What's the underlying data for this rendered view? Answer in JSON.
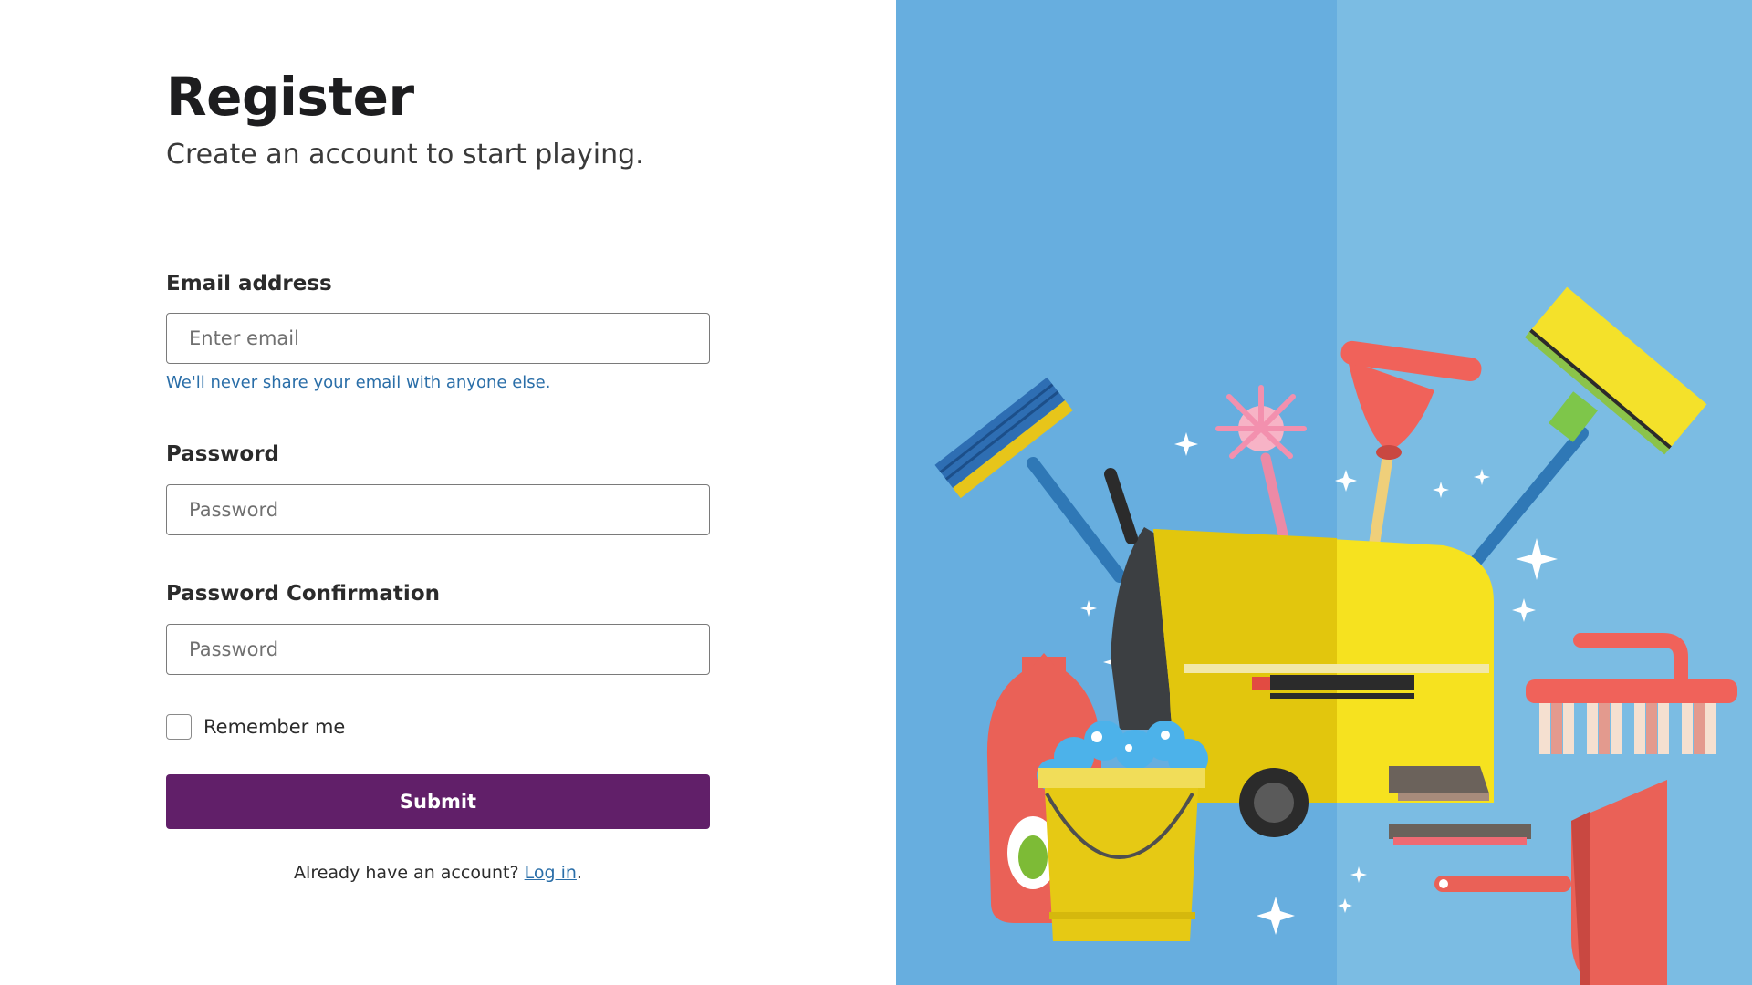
{
  "register": {
    "title": "Register",
    "subtitle": "Create an account to start playing.",
    "email": {
      "label": "Email address",
      "placeholder": "Enter email",
      "help": "We'll never share your email with anyone else."
    },
    "password": {
      "label": "Password",
      "placeholder": "Password"
    },
    "password_confirmation": {
      "label": "Password Confirmation",
      "placeholder": "Password"
    },
    "remember_label": "Remember me",
    "submit_label": "Submit",
    "login_prompt": "Already have an account?",
    "login_link": "Log in",
    "login_suffix": "."
  },
  "colors": {
    "accent": "#611f69",
    "link": "#2a6ea8",
    "panel_left": "#67aedf",
    "panel_right": "#7bbce3"
  },
  "illustration": {
    "subject": "cleaning-supplies-illustration"
  }
}
